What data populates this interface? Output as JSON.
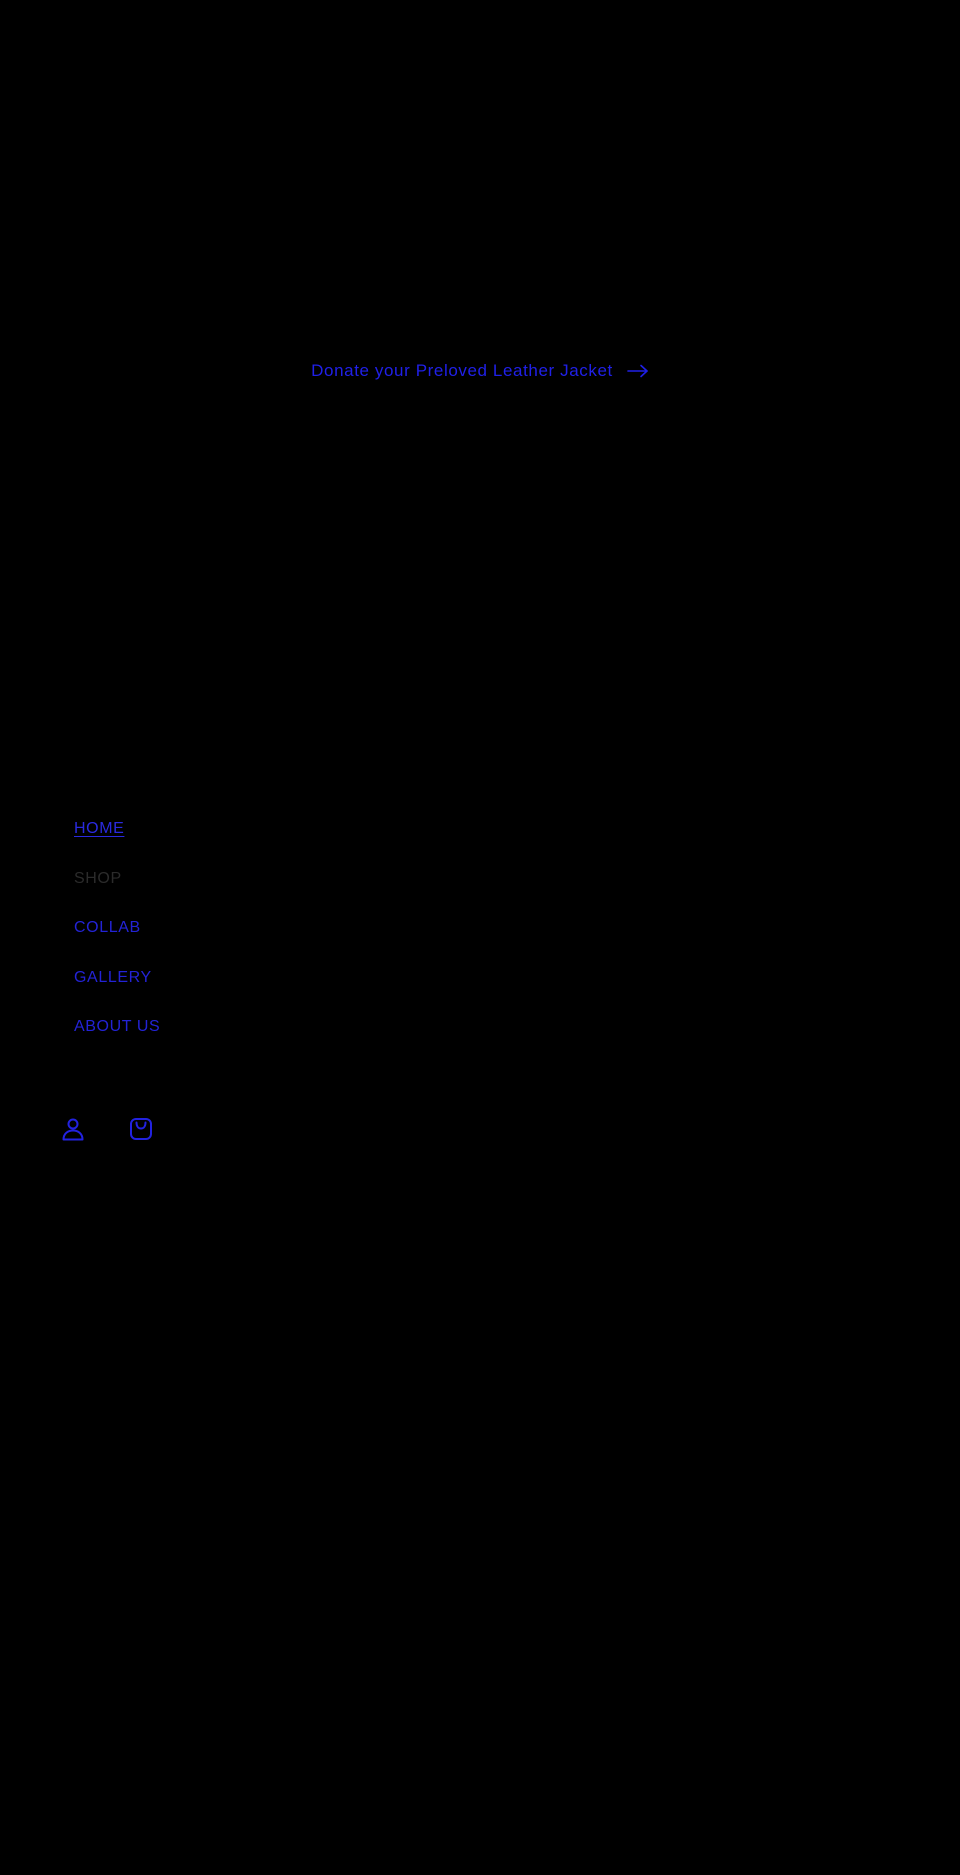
{
  "announcement": {
    "text": "Donate your Preloved Leather Jacket",
    "arrow_icon": "arrow-right-icon"
  },
  "menu": {
    "items": [
      {
        "label": "HOME",
        "active": true
      },
      {
        "label": "SHOP",
        "active": false
      },
      {
        "label": "COLLAB",
        "active": false
      },
      {
        "label": "GALLERY",
        "active": false
      },
      {
        "label": "ABOUT US",
        "active": false
      }
    ]
  },
  "utility_icons": {
    "account": "account-icon",
    "cart": "cart-icon"
  },
  "colors": {
    "background": "#000000",
    "link": "#2323d6",
    "muted": "#2b2b2b"
  }
}
